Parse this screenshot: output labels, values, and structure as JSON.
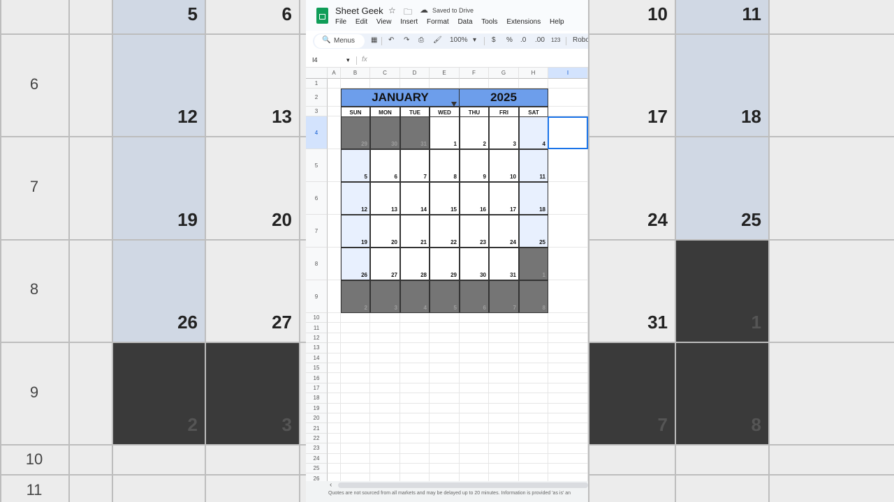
{
  "background": {
    "row_labels": [
      "6",
      "7",
      "8",
      "9",
      "10",
      "11"
    ],
    "cells": [
      {
        "num": "5",
        "shade": "#d0d8e4"
      },
      {
        "num": "6",
        "shade": "#ececec"
      },
      {
        "num": "10",
        "shade": "#ececec"
      },
      {
        "num": "11",
        "shade": "#d0d8e4"
      },
      {
        "num": "12",
        "shade": "#d0d8e4"
      },
      {
        "num": "13",
        "shade": "#ececec"
      },
      {
        "num": "17",
        "shade": "#ececec"
      },
      {
        "num": "18",
        "shade": "#d0d8e4"
      },
      {
        "num": "19",
        "shade": "#d0d8e4"
      },
      {
        "num": "20",
        "shade": "#ececec"
      },
      {
        "num": "24",
        "shade": "#ececec"
      },
      {
        "num": "25",
        "shade": "#d0d8e4"
      },
      {
        "num": "26",
        "shade": "#d0d8e4"
      },
      {
        "num": "27",
        "shade": "#ececec"
      },
      {
        "num": "31",
        "shade": "#ececec"
      },
      {
        "num": "1",
        "shade": "#3a3a3a"
      },
      {
        "num": "2",
        "shade": "#3a3a3a"
      },
      {
        "num": "3",
        "shade": "#3a3a3a"
      },
      {
        "num": "7",
        "shade": "#3a3a3a"
      },
      {
        "num": "8",
        "shade": "#3a3a3a"
      }
    ]
  },
  "app": {
    "title": "Sheet Geek",
    "saved_status": "Saved to Drive",
    "menu": [
      "File",
      "Edit",
      "View",
      "Insert",
      "Format",
      "Data",
      "Tools",
      "Extensions",
      "Help"
    ],
    "toolbar": {
      "search_label": "Menus",
      "zoom": "100%",
      "currency": "$",
      "percent": "%",
      "dec_decrease": ".0",
      "dec_increase": ".00",
      "number_format": "123",
      "font": "Robo"
    },
    "name_box": "I4",
    "fx": "fx"
  },
  "grid": {
    "columns": [
      "A",
      "B",
      "C",
      "D",
      "E",
      "F",
      "G",
      "H",
      "I"
    ],
    "selected_column": "I",
    "selected_row": "4",
    "rows": [
      "1",
      "2",
      "3",
      "4",
      "5",
      "6",
      "7",
      "8",
      "9",
      "10",
      "11",
      "12",
      "13",
      "14",
      "15",
      "16",
      "17",
      "18",
      "19",
      "20",
      "21",
      "22",
      "23",
      "24",
      "25",
      "26"
    ]
  },
  "calendar": {
    "month": "JANUARY",
    "year": "2025",
    "weekdays": [
      "SUN",
      "MON",
      "TUE",
      "WED",
      "THU",
      "FRI",
      "SAT"
    ],
    "weeks": [
      [
        {
          "d": "29",
          "t": "other"
        },
        {
          "d": "30",
          "t": "other"
        },
        {
          "d": "31",
          "t": "other"
        },
        {
          "d": "1",
          "t": "day"
        },
        {
          "d": "2",
          "t": "day"
        },
        {
          "d": "3",
          "t": "day"
        },
        {
          "d": "4",
          "t": "weekend"
        }
      ],
      [
        {
          "d": "5",
          "t": "weekend"
        },
        {
          "d": "6",
          "t": "day"
        },
        {
          "d": "7",
          "t": "day"
        },
        {
          "d": "8",
          "t": "day"
        },
        {
          "d": "9",
          "t": "day"
        },
        {
          "d": "10",
          "t": "day"
        },
        {
          "d": "11",
          "t": "weekend"
        }
      ],
      [
        {
          "d": "12",
          "t": "weekend"
        },
        {
          "d": "13",
          "t": "day"
        },
        {
          "d": "14",
          "t": "day"
        },
        {
          "d": "15",
          "t": "day"
        },
        {
          "d": "16",
          "t": "day"
        },
        {
          "d": "17",
          "t": "day"
        },
        {
          "d": "18",
          "t": "weekend"
        }
      ],
      [
        {
          "d": "19",
          "t": "weekend"
        },
        {
          "d": "20",
          "t": "day"
        },
        {
          "d": "21",
          "t": "day"
        },
        {
          "d": "22",
          "t": "day"
        },
        {
          "d": "23",
          "t": "day"
        },
        {
          "d": "24",
          "t": "day"
        },
        {
          "d": "25",
          "t": "weekend"
        }
      ],
      [
        {
          "d": "26",
          "t": "weekend"
        },
        {
          "d": "27",
          "t": "day"
        },
        {
          "d": "28",
          "t": "day"
        },
        {
          "d": "29",
          "t": "day"
        },
        {
          "d": "30",
          "t": "day"
        },
        {
          "d": "31",
          "t": "day"
        },
        {
          "d": "1",
          "t": "other"
        }
      ],
      [
        {
          "d": "2",
          "t": "other"
        },
        {
          "d": "3",
          "t": "other"
        },
        {
          "d": "4",
          "t": "other"
        },
        {
          "d": "5",
          "t": "other"
        },
        {
          "d": "6",
          "t": "other"
        },
        {
          "d": "7",
          "t": "other"
        },
        {
          "d": "8",
          "t": "other"
        }
      ]
    ]
  },
  "footer": {
    "disclaimer": "Quotes are not sourced from all markets and may be delayed up to 20 minutes. Information is provided 'as is' an"
  },
  "colors": {
    "header_blue": "#6d9eeb",
    "weekend": "#e8f0fe",
    "other_month": "#757575",
    "selection": "#1a73e8"
  }
}
